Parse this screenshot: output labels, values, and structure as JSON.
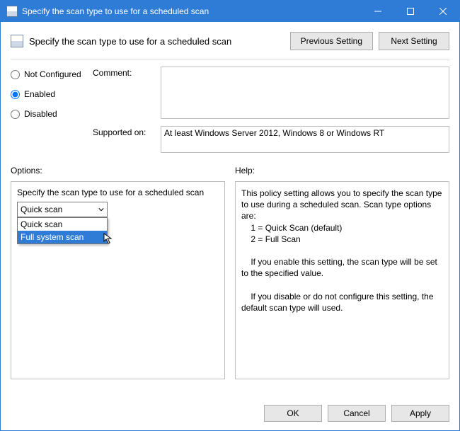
{
  "title": "Specify the scan type to use for a scheduled scan",
  "header_title": "Specify the scan type to use for a scheduled scan",
  "nav": {
    "prev": "Previous Setting",
    "next": "Next Setting"
  },
  "state": {
    "not_configured": "Not Configured",
    "enabled": "Enabled",
    "disabled": "Disabled",
    "selected": "enabled"
  },
  "labels": {
    "comment": "Comment:",
    "supported": "Supported on:",
    "options": "Options:",
    "help": "Help:"
  },
  "comment_value": "",
  "supported_value": "At least Windows Server 2012, Windows 8 or Windows RT",
  "options": {
    "title": "Specify the scan type to use for a scheduled scan",
    "selected": "Quick scan",
    "items": [
      "Quick scan",
      "Full system scan"
    ],
    "highlight_index": 1
  },
  "help_text": "This policy setting allows you to specify the scan type to use during a scheduled scan. Scan type options are:\n    1 = Quick Scan (default)\n    2 = Full Scan\n\n    If you enable this setting, the scan type will be set to the specified value.\n\n    If you disable or do not configure this setting, the default scan type will used.",
  "buttons": {
    "ok": "OK",
    "cancel": "Cancel",
    "apply": "Apply"
  }
}
